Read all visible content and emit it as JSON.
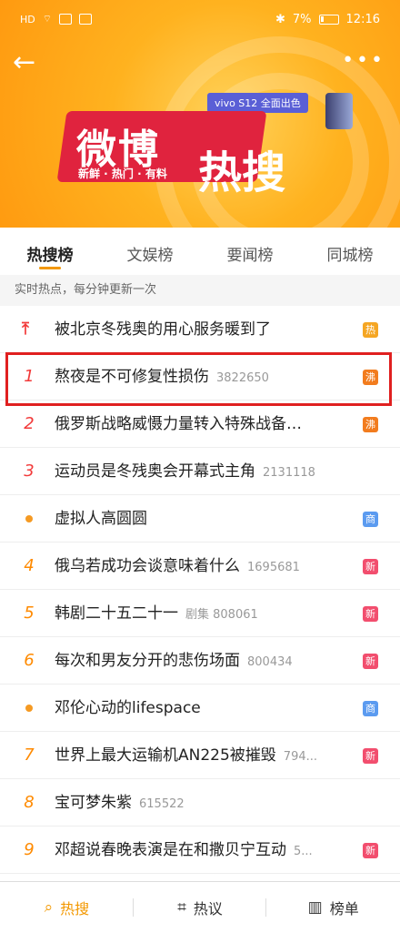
{
  "status_bar": {
    "network": "HD",
    "battery": "7%",
    "time": "12:16"
  },
  "banner": {
    "title1": "微博",
    "title2": "热搜",
    "tagline": "新鲜 · 热门 · 有料",
    "ad_text": "vivo S12 全面出色"
  },
  "tabs": [
    {
      "label": "热搜榜"
    },
    {
      "label": "文娱榜"
    },
    {
      "label": "要闻榜"
    },
    {
      "label": "同城榜"
    }
  ],
  "subhead": "实时热点，每分钟更新一次",
  "items": [
    {
      "rank": "",
      "marker": "pin",
      "title": "被北京冬残奥的用心服务暖到了",
      "meta": "",
      "badge": "热",
      "badge_color": "#f5a623"
    },
    {
      "rank": "1",
      "marker": "red",
      "title": "熬夜是不可修复性损伤",
      "meta": "3822650",
      "badge": "沸",
      "badge_color": "#f27c1e"
    },
    {
      "rank": "2",
      "marker": "red",
      "title": "俄罗斯战略威慑力量转入特殊战备…",
      "meta": "",
      "badge": "沸",
      "badge_color": "#f27c1e"
    },
    {
      "rank": "3",
      "marker": "red",
      "title": "运动员是冬残奥会开幕式主角",
      "meta": "2131118",
      "badge": "",
      "badge_color": ""
    },
    {
      "rank": "",
      "marker": "dot",
      "title": "虚拟人高圆圆",
      "meta": "",
      "badge": "商",
      "badge_color": "#5b9bf0"
    },
    {
      "rank": "4",
      "marker": "orange",
      "title": "俄乌若成功会谈意味着什么",
      "meta": "1695681",
      "badge": "新",
      "badge_color": "#f24e6e"
    },
    {
      "rank": "5",
      "marker": "orange",
      "title": "韩剧二十五二十一",
      "meta": "剧集 808061",
      "badge": "新",
      "badge_color": "#f24e6e"
    },
    {
      "rank": "6",
      "marker": "orange",
      "title": "每次和男友分开的悲伤场面",
      "meta": "800434",
      "badge": "新",
      "badge_color": "#f24e6e"
    },
    {
      "rank": "",
      "marker": "dot",
      "title": "邓伦心动的lifespace",
      "meta": "",
      "badge": "商",
      "badge_color": "#5b9bf0"
    },
    {
      "rank": "7",
      "marker": "orange",
      "title": "世界上最大运输机AN225被摧毁",
      "meta": "794...",
      "badge": "新",
      "badge_color": "#f24e6e"
    },
    {
      "rank": "8",
      "marker": "orange",
      "title": "宝可梦朱紫",
      "meta": "615522",
      "badge": "",
      "badge_color": ""
    },
    {
      "rank": "9",
      "marker": "orange",
      "title": "邓超说春晚表演是在和撒贝宁互动",
      "meta": "5...",
      "badge": "新",
      "badge_color": "#f24e6e"
    }
  ],
  "bottom_nav": [
    {
      "label": "热搜",
      "icon": "search-icon"
    },
    {
      "label": "热议",
      "icon": "discussion-icon"
    },
    {
      "label": "榜单",
      "icon": "chart-icon"
    }
  ],
  "colors": {
    "accent": "#f39800",
    "highlight_border": "#e02020"
  }
}
